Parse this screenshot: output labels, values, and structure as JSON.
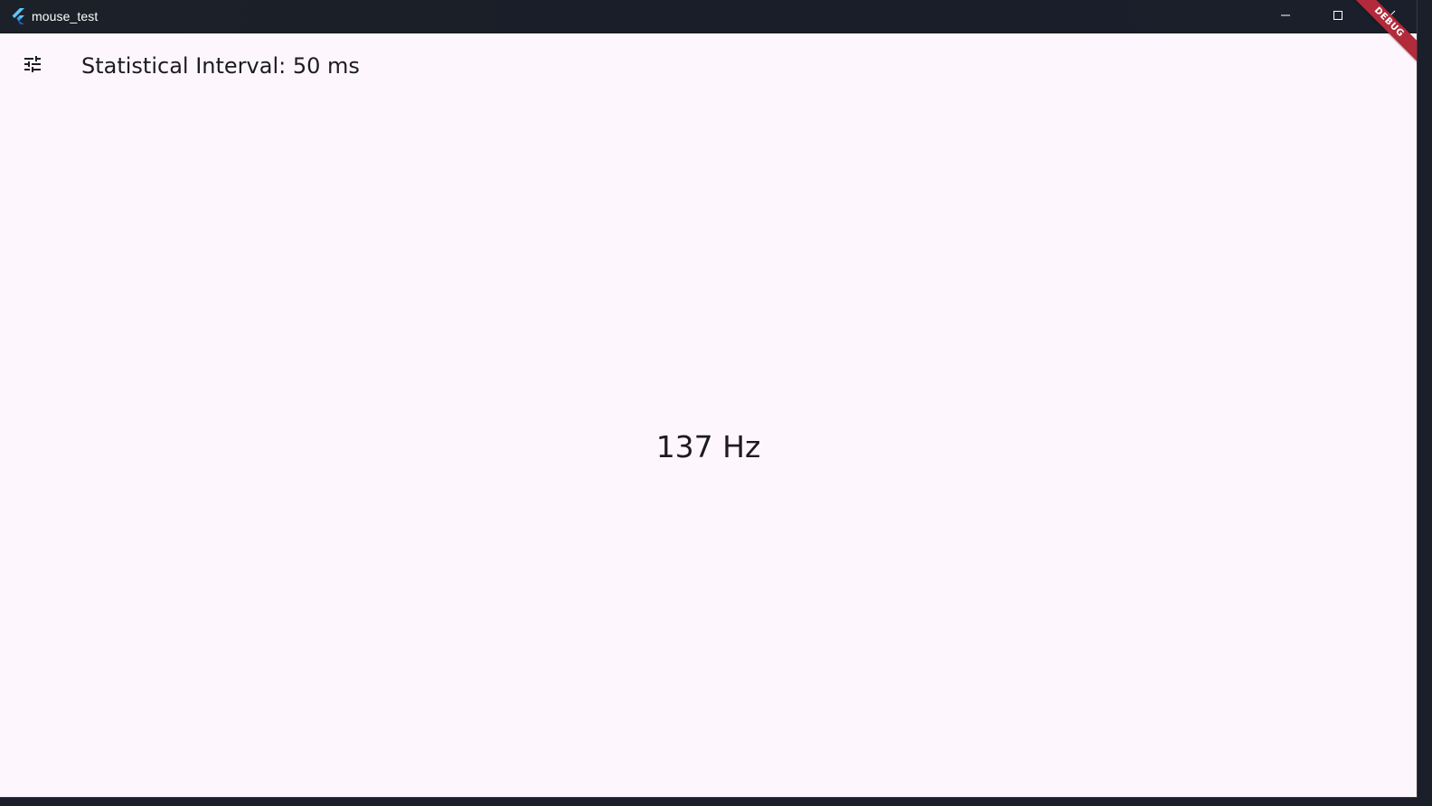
{
  "window": {
    "title": "mouse_test",
    "app_icon": "flutter-logo-icon",
    "caption_buttons": {
      "minimize_icon": "minimize-icon",
      "maximize_icon": "maximize-icon",
      "close_icon": "close-icon"
    }
  },
  "toolbar": {
    "settings_icon": "tune-icon",
    "title": "Statistical Interval: 50 ms"
  },
  "main": {
    "rate_readout": "137 Hz"
  },
  "debug_banner": {
    "label": "DEBUG",
    "color": "#b22a3b"
  },
  "colors": {
    "background": "#fdf7fd",
    "titlebar": "#1c2029",
    "text": "#1d1b20"
  }
}
